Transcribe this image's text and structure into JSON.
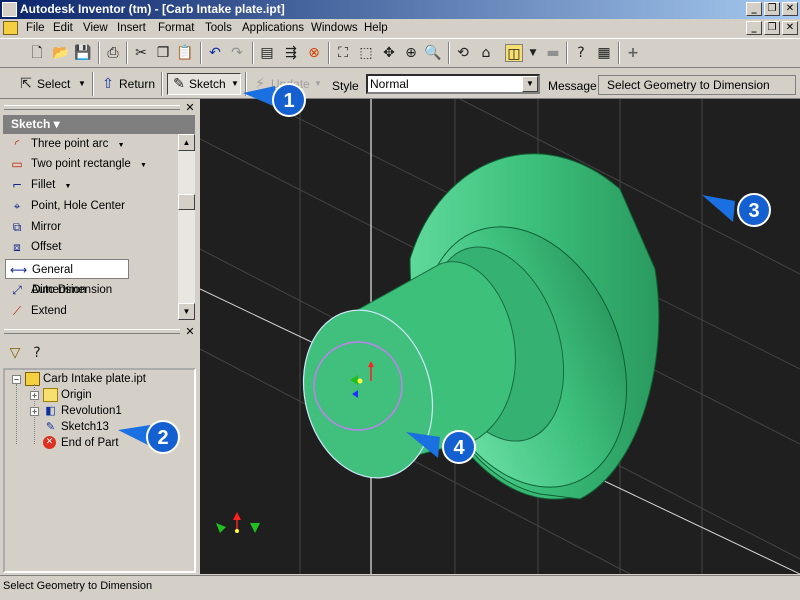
{
  "window": {
    "title": "Autodesk Inventor (tm) - [Carb Intake plate.ipt]",
    "controls": [
      "_",
      "❐",
      "✕"
    ],
    "doc_controls": [
      "_",
      "❐",
      "✕"
    ]
  },
  "menu": [
    "File",
    "Edit",
    "View",
    "Insert",
    "Format",
    "Tools",
    "Applications",
    "Windows",
    "Help"
  ],
  "toolbar2": {
    "select_label": "Select",
    "return_label": "Return",
    "sketch_label": "Sketch",
    "update_label": "Update",
    "style_label": "Style",
    "style_value": "Normal",
    "message_label": "Message",
    "message_value": "Select Geometry to Dimension"
  },
  "sketch_panel": {
    "header": "Sketch ▾",
    "items": [
      {
        "label": "Three point arc",
        "icon": "arc-icon",
        "dropdown": true
      },
      {
        "label": "Two point rectangle",
        "icon": "rectangle-icon",
        "dropdown": true
      },
      {
        "label": "Fillet",
        "icon": "fillet-icon",
        "dropdown": true
      },
      {
        "label": "Point, Hole Center",
        "icon": "point-icon",
        "dropdown": false
      },
      {
        "label": "Mirror",
        "icon": "mirror-icon",
        "dropdown": false
      },
      {
        "label": "Offset",
        "icon": "offset-icon",
        "dropdown": false
      },
      {
        "label": "General Dimension",
        "icon": "dimension-icon",
        "dropdown": false,
        "selected": true
      },
      {
        "label": "Auto Dimension",
        "icon": "auto-dimension-icon",
        "dropdown": false
      },
      {
        "label": "Extend",
        "icon": "extend-icon",
        "dropdown": false
      }
    ]
  },
  "browser": {
    "root": "Carb Intake plate.ipt",
    "nodes": [
      "Origin",
      "Revolution1",
      "Sketch13",
      "End of Part"
    ]
  },
  "callouts": [
    "1",
    "2",
    "3",
    "4"
  ],
  "status": "Select Geometry to Dimension",
  "colors": {
    "part_green": "#3fbf7f",
    "viewport_bg": "#1f1f1f",
    "callout_blue": "#1060d0",
    "title_blue": "#0a246a"
  }
}
